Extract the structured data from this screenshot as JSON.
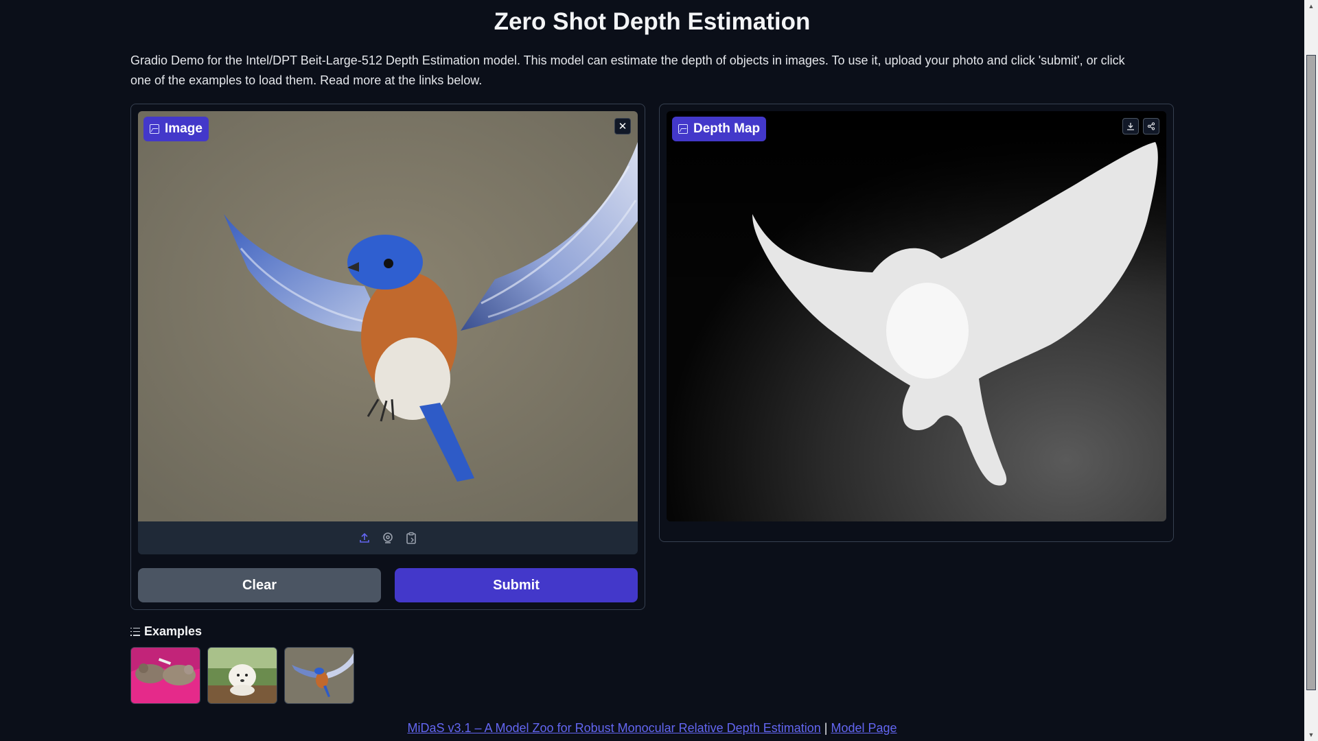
{
  "header": {
    "title": "Zero Shot Depth Estimation",
    "description": "Gradio Demo for the Intel/DPT Beit-Large-512 Depth Estimation model. This model can estimate the depth of objects in images. To use it, upload your photo and click 'submit', or click one of the examples to load them. Read more at the links below."
  },
  "input": {
    "label": "Image",
    "image_icon": "image-icon",
    "close_icon": "close-icon",
    "toolbar_icons": [
      "upload-icon",
      "webcam-icon",
      "clipboard-icon"
    ]
  },
  "output": {
    "label": "Depth Map",
    "action_icons": [
      "download-icon",
      "share-icon"
    ]
  },
  "buttons": {
    "clear": "Clear",
    "submit": "Submit"
  },
  "examples": {
    "title": "Examples",
    "items": [
      "cats-example",
      "puppy-example",
      "bird-example"
    ]
  },
  "footer": {
    "link1": "MiDaS v3.1 – A Model Zoo for Robust Monocular Relative Depth Estimation",
    "separator": "|",
    "link2": "Model Page"
  },
  "colors": {
    "background": "#0b0f19",
    "accent": "#4338ca",
    "secondary_button": "#4b5563",
    "link": "#6366f1"
  }
}
